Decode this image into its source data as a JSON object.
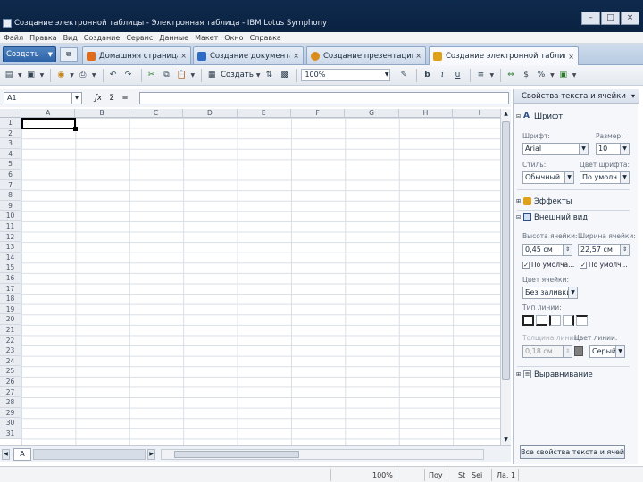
{
  "window": {
    "title": "Создание электронной таблицы - Электронная таблица - IBM Lotus Symphony",
    "min": "–",
    "max": "□",
    "close": "×"
  },
  "menu": [
    "Файл",
    "Правка",
    "Вид",
    "Создание",
    "Сервис",
    "Данные",
    "Макет",
    "Окно",
    "Справка"
  ],
  "tabs": {
    "create_label": "Создать",
    "items": [
      {
        "label": "Домашняя страница",
        "color": "#e06b1a"
      },
      {
        "label": "Создание документа",
        "color": "#2d6bc4"
      },
      {
        "label": "Создание презентации",
        "color": "#d98b1c"
      },
      {
        "label": "Создание электронной таблицы",
        "color": "#e0a11a"
      }
    ],
    "close_glyph": "×"
  },
  "toolbar": {
    "create_label": "Создать",
    "zoom": "100%"
  },
  "formula": {
    "cell_ref": "A1",
    "fx": "ƒx",
    "sum": "Σ",
    "eq": "="
  },
  "grid": {
    "columns": [
      "A",
      "B",
      "C",
      "D",
      "E",
      "F",
      "G",
      "H",
      "I"
    ],
    "rows": [
      "1",
      "2",
      "3",
      "4",
      "5",
      "6",
      "7",
      "8",
      "9",
      "10",
      "11",
      "12",
      "13",
      "14",
      "15",
      "16",
      "17",
      "18",
      "19",
      "20",
      "21",
      "22",
      "23",
      "24",
      "25",
      "26",
      "27",
      "28",
      "29",
      "30",
      "31"
    ],
    "active_cell": "A1"
  },
  "sheet": {
    "tab": "A"
  },
  "status": {
    "zoom": "100%",
    "mode": "Поу",
    "sel": "St",
    "sheet": "Sei",
    "page": "Ла, 1"
  },
  "sidebar": {
    "title": "Свойства текста и ячейки",
    "font_section": "Шрифт",
    "font_label": "Шрифт:",
    "font_value": "Arial",
    "size_label": "Размер:",
    "size_value": "10",
    "style_label": "Стиль:",
    "style_value": "Обычный",
    "color_label": "Цвет шрифта:",
    "color_value": "По умолч",
    "effects_section": "Эффекты",
    "view_section": "Внешний вид",
    "height_label": "Высота ячейки:",
    "height_value": "0,45 см",
    "width_label": "Ширина ячейки:",
    "width_value": "22,57 см",
    "default_h": "По умолча...",
    "default_w": "По умолч...",
    "cell_color_label": "Цвет ячейки:",
    "cell_color_value": "Без заливки",
    "border_label": "Тип линии:",
    "line_width_label": "Толщина линии:",
    "line_width_value": "0,18 см",
    "line_color_label": "Цвет линии:",
    "line_color_value": "Серый",
    "align_section": "Выравнивание",
    "all_props_btn": "Все свойства текста и ячейки..."
  }
}
